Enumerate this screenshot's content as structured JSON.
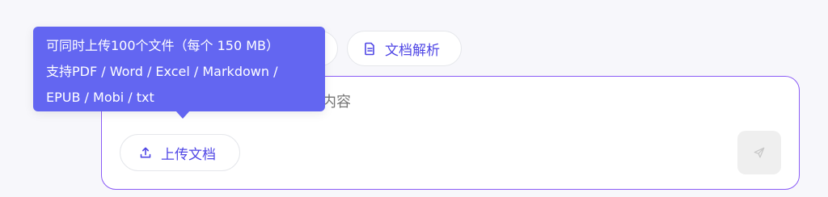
{
  "chips": {
    "doc_parse_label": "文档解析"
  },
  "composer": {
    "placeholder": "问题，例如：总结这个文档的内容",
    "upload_label": "上传文档"
  },
  "tooltip": {
    "lines": [
      "可同时上传100个文件（每个 150 MB）",
      "支持PDF / Word / Excel / Markdown /",
      "EPUB / Mobi / txt"
    ]
  },
  "icons": {
    "doc_parse": "document-icon",
    "upload": "upload-icon",
    "send": "send-icon"
  },
  "colors": {
    "accent": "#4f46e5",
    "tooltip_bg": "#6366f1",
    "border": "#8b5cf6",
    "placeholder": "#a3a3ad",
    "send_bg": "#efefef"
  }
}
